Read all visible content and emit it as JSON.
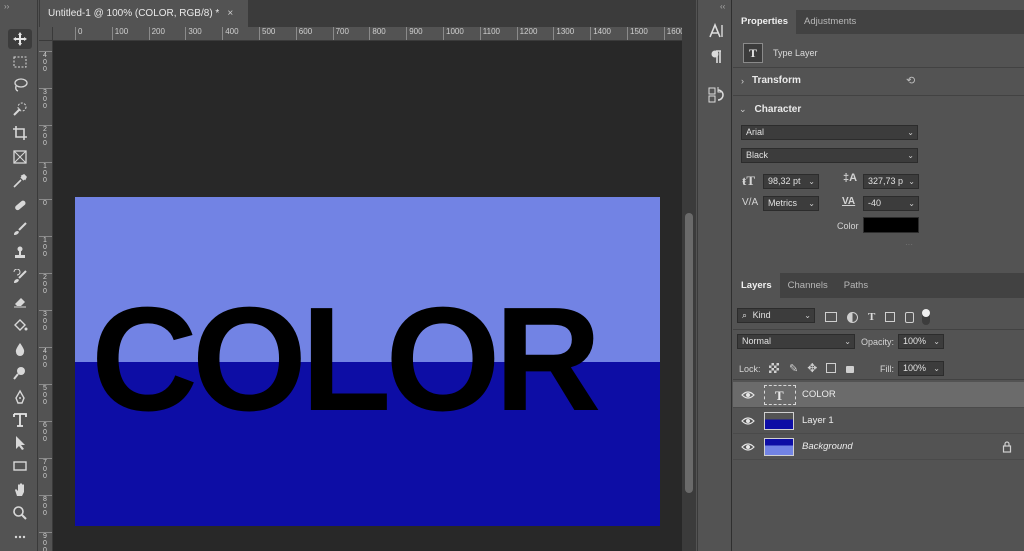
{
  "colors": {
    "canvas_top": "#7283e4",
    "canvas_bottom": "#0d0da5",
    "text_color": "#000000",
    "ui_bg": "#535353",
    "workspace_bg": "#282828"
  },
  "toolbar": {
    "collapse": "››",
    "tools": [
      "move-tool",
      "marquee-tool",
      "lasso-tool",
      "quick-selection-tool",
      "crop-tool",
      "frame-tool",
      "eyedropper-tool",
      "healing-brush-tool",
      "brush-tool",
      "clone-stamp-tool",
      "history-brush-tool",
      "eraser-tool",
      "paint-bucket-tool",
      "blur-tool",
      "dodge-tool",
      "pen-tool",
      "type-tool",
      "path-selection-tool",
      "rectangle-tool",
      "hand-tool",
      "zoom-tool",
      "more-tools"
    ]
  },
  "document": {
    "tab_title": "Untitled-1 @ 100% (COLOR, RGB/8) *",
    "tab_close": "×",
    "ruler_h": [
      "0",
      "100",
      "200",
      "300",
      "400",
      "500",
      "600",
      "700",
      "800",
      "900",
      "1000",
      "1100",
      "1200",
      "1300",
      "1400",
      "1500",
      "1600"
    ],
    "ruler_v": [
      "4\n0\n0",
      "3\n0\n0",
      "2\n0\n0",
      "1\n0\n0",
      "0",
      "1\n0\n0",
      "2\n0\n0",
      "3\n0\n0",
      "4\n0\n0",
      "5\n0\n0",
      "6\n0\n0",
      "7\n0\n0",
      "8\n0\n0",
      "9\n0\n0"
    ],
    "canvas_text": "COLOR"
  },
  "midstrip": {
    "collapse": "‹‹",
    "icons": [
      "character-panel-icon",
      "paragraph-panel-icon",
      "glyphs-panel-icon"
    ]
  },
  "properties": {
    "tabs": [
      "Properties",
      "Adjustments"
    ],
    "layer_kind": "Type Layer",
    "transform_label": "Transform",
    "character_label": "Character",
    "font_family": "Arial",
    "font_style": "Black",
    "font_size": "98,32 pt",
    "leading": "327,73 p",
    "kerning": "Metrics",
    "tracking": "-40",
    "color_label": "Color",
    "color_value": "#000000"
  },
  "layers": {
    "tabs": [
      "Layers",
      "Channels",
      "Paths"
    ],
    "filter_kind": "Kind",
    "blend_mode": "Normal",
    "opacity_label": "Opacity:",
    "opacity": "100%",
    "lock_label": "Lock:",
    "fill_label": "Fill:",
    "fill": "100%",
    "items": [
      {
        "name": "COLOR",
        "type": "text",
        "selected": true
      },
      {
        "name": "Layer 1",
        "type": "image",
        "selected": false
      },
      {
        "name": "Background",
        "type": "background",
        "selected": false,
        "locked": true
      }
    ]
  }
}
